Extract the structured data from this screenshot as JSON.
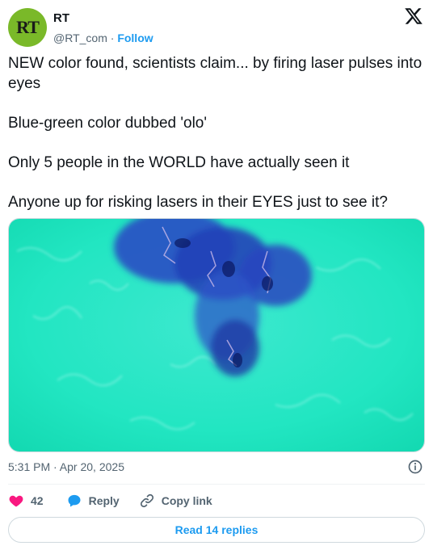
{
  "author": {
    "avatar_text": "RT",
    "display_name": "RT",
    "handle": "@RT_com",
    "separator": " · ",
    "follow_label": "Follow"
  },
  "brand_icon": "x-logo-icon",
  "tweet": {
    "paragraphs": [
      "NEW color found, scientists claim... by firing laser pulses into eyes",
      "Blue-green color dubbed 'olo'",
      "Only 5 people in the WORLD have actually seen it",
      "Anyone up for risking lasers in their EYES just to see it?"
    ]
  },
  "media": {
    "kind": "image",
    "dominant_color": "#27e8c8"
  },
  "meta": {
    "timestamp": "5:31 PM · Apr 20, 2025",
    "info_icon": "info-icon"
  },
  "actions": {
    "like_count": "42",
    "reply_label": "Reply",
    "copy_link_label": "Copy link"
  },
  "read_replies_label": "Read 14 replies",
  "colors": {
    "accent": "#1d9bf0",
    "like": "#f91880",
    "text": "#0f1419",
    "muted": "#536471",
    "avatar_bg": "#7ab929"
  }
}
